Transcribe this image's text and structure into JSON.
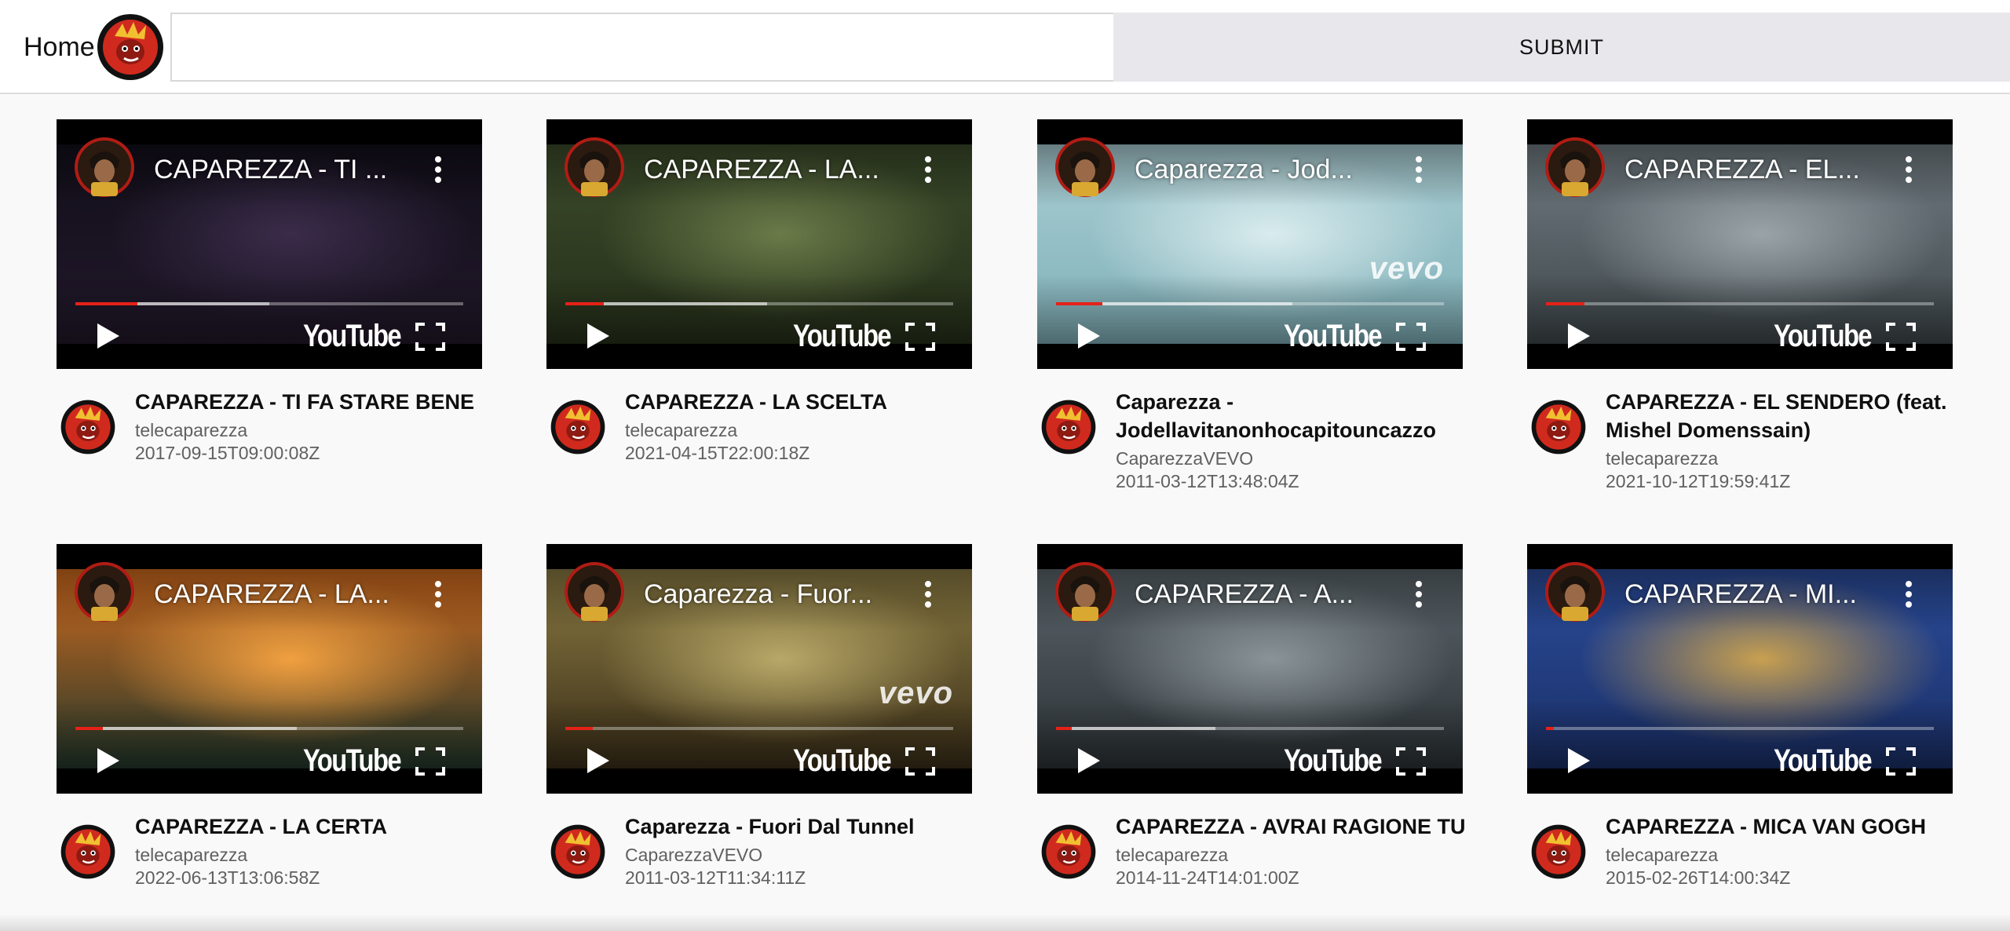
{
  "header": {
    "home_label": "Home",
    "logo_icon": "caparezza-logo-icon",
    "search_value": "",
    "search_placeholder": "",
    "submit_label": "SUBMIT"
  },
  "player_ui": {
    "logo_text": "YouTube",
    "vevo_text": "vevo",
    "accent": "#e62117"
  },
  "videos": [
    {
      "title": "CAPAREZZA - TI FA STARE BENE",
      "player_title": "CAPAREZZA - TI ...",
      "channel": "telecaparezza",
      "published": "2017-09-15T09:00:08Z",
      "progress": 0.16,
      "loaded": 0.5,
      "vevo": false,
      "thumb": {
        "top": "#120f1a",
        "bottom": "#22182a",
        "accent": "#3a2c4a"
      }
    },
    {
      "title": "CAPAREZZA - LA SCELTA",
      "player_title": "CAPAREZZA - LA...",
      "channel": "telecaparezza",
      "published": "2021-04-15T22:00:18Z",
      "progress": 0.1,
      "loaded": 0.52,
      "vevo": false,
      "thumb": {
        "top": "#3b4a2a",
        "bottom": "#26301a",
        "accent": "#6a7a48"
      }
    },
    {
      "title": "Caparezza - Jodellavitanonhocapitouncazzo",
      "player_title": "Caparezza - Jod...",
      "channel": "CaparezzaVEVO",
      "published": "2011-03-12T13:48:04Z",
      "progress": 0.12,
      "loaded": 0.61,
      "vevo": true,
      "thumb": {
        "top": "#a9cdd3",
        "bottom": "#7fb0b8",
        "accent": "#d9ecee"
      }
    },
    {
      "title": "CAPAREZZA - EL SENDERO (feat. Mishel Domenssain)",
      "player_title": "CAPAREZZA - EL...",
      "channel": "telecaparezza",
      "published": "2021-10-12T19:59:41Z",
      "progress": 0.1,
      "loaded": 0.0,
      "vevo": false,
      "thumb": {
        "top": "#6f7a80",
        "bottom": "#3f474b",
        "accent": "#9aa4a8"
      }
    },
    {
      "title": "CAPAREZZA - LA CERTA",
      "player_title": "CAPAREZZA - LA...",
      "channel": "telecaparezza",
      "published": "2022-06-13T13:06:58Z",
      "progress": 0.07,
      "loaded": 0.57,
      "vevo": false,
      "thumb": {
        "top": "#d06a1e",
        "bottom": "#22382c",
        "accent": "#f0a040"
      }
    },
    {
      "title": "Caparezza - Fuori Dal Tunnel",
      "player_title": "Caparezza - Fuor...",
      "channel": "CaparezzaVEVO",
      "published": "2011-03-12T11:34:11Z",
      "progress": 0.07,
      "loaded": 0.0,
      "vevo": true,
      "thumb": {
        "top": "#8a7a42",
        "bottom": "#3a2e18",
        "accent": "#b8a868"
      }
    },
    {
      "title": "CAPAREZZA - AVRAI RAGIONE TU",
      "player_title": "CAPAREZZA - A...",
      "channel": "telecaparezza",
      "published": "2014-11-24T14:01:00Z",
      "progress": 0.04,
      "loaded": 0.41,
      "vevo": false,
      "thumb": {
        "top": "#5a646a",
        "bottom": "#2c3236",
        "accent": "#8a9498"
      }
    },
    {
      "title": "CAPAREZZA - MICA VAN GOGH",
      "player_title": "CAPAREZZA - MI...",
      "channel": "telecaparezza",
      "published": "2015-02-26T14:00:34Z",
      "progress": 0.02,
      "loaded": 0.0,
      "vevo": false,
      "thumb": {
        "top": "#2b4c9a",
        "bottom": "#1a2f66",
        "accent": "#c8a050"
      }
    }
  ]
}
